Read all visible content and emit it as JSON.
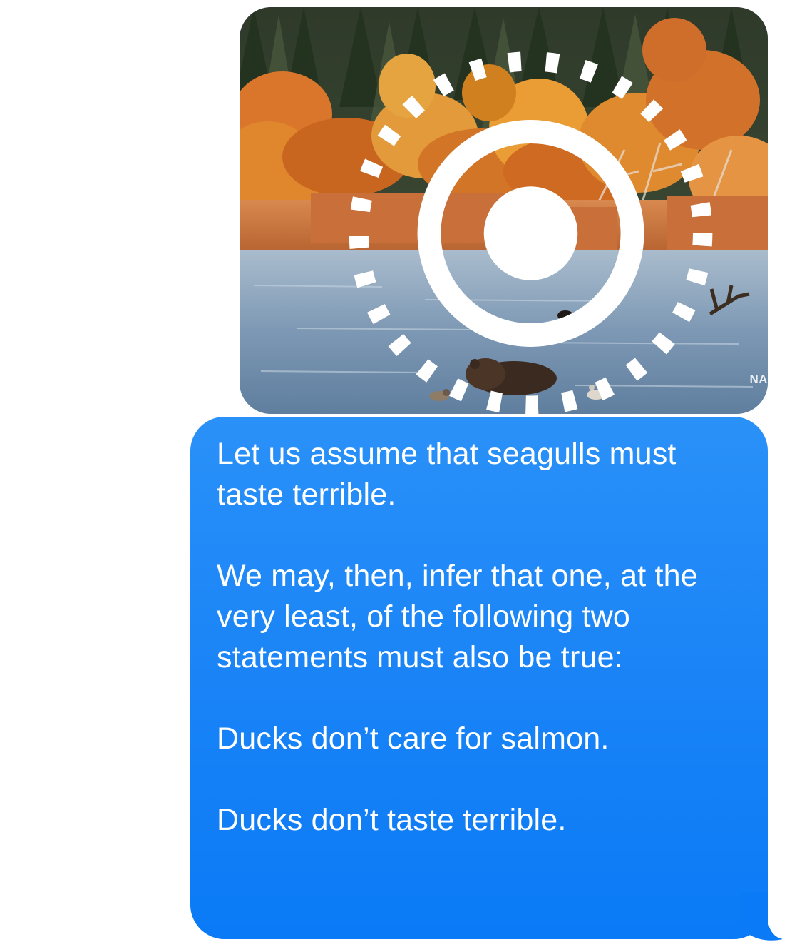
{
  "conversation": {
    "photo_message": {
      "live_photo_icon": "live-photo-icon",
      "watermark_text": "NA"
    },
    "text_message": {
      "paragraphs": [
        "Let us assume that seagulls must taste terrible.",
        "We may, then, infer that one, at the very least, of the following two statements must also be true:",
        "Ducks don’t care for salmon.",
        "Ducks don’t taste terrible."
      ]
    },
    "colors": {
      "bubble_top": "#2a91f8",
      "bubble_bottom": "#0a7af6",
      "text": "#ffffff",
      "background": "#ffffff"
    }
  }
}
